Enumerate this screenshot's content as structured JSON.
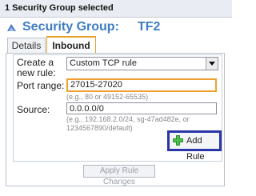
{
  "header": {
    "selection_text": "1 Security Group selected"
  },
  "title": {
    "label": "Security Group:",
    "value": "TF2"
  },
  "tabs": [
    {
      "label": "Details",
      "active": false
    },
    {
      "label": "Inbound",
      "active": true
    }
  ],
  "form": {
    "create_rule_label_line1": "Create a",
    "create_rule_label_line2": "new rule:",
    "rule_type_selected": "Custom TCP rule",
    "port_range_label": "Port range:",
    "port_range_value": "27015-27020",
    "port_range_hint": "(e.g., 80 or 49152-65535)",
    "source_label": "Source:",
    "source_value": "0.0.0.0/0",
    "source_hint_line1": "(e.g., 192.168.2.0/24, sg-47ad482e, or",
    "source_hint_line2": "1234567890/default)",
    "add_rule_label": "Add Rule"
  },
  "footer": {
    "apply_label": "Apply Rule Changes"
  },
  "colors": {
    "title": "#3e7cc0",
    "focus_border": "#f0a030",
    "add_rule_highlight": "#2a36a8",
    "plus_icon": "#3aa63a"
  },
  "icons": {
    "security_group": "shield-arrow-icon",
    "add": "green-plus-icon",
    "dropdown": "chevron-down-icon"
  }
}
